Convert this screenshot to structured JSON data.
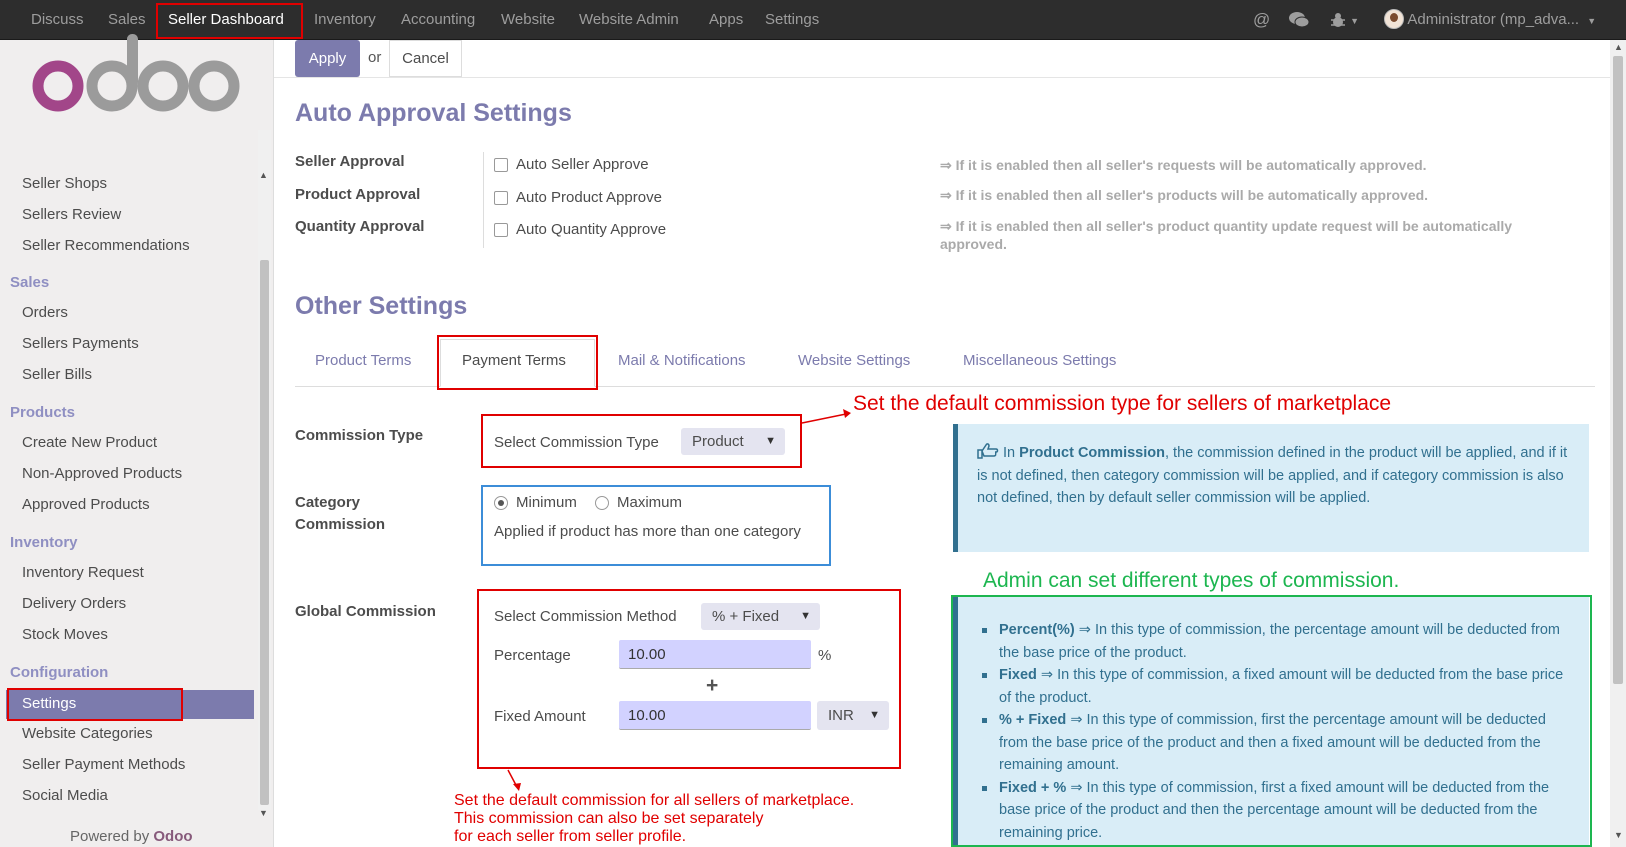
{
  "nav": {
    "items": [
      "Discuss",
      "Sales",
      "Seller Dashboard",
      "Inventory",
      "Accounting",
      "Website",
      "Website Admin",
      "Apps",
      "Settings"
    ],
    "user": "Administrator (mp_adva..."
  },
  "sidebar": {
    "logo_text": "odoo",
    "top_links": [
      "Seller Shops",
      "Sellers Review",
      "Seller Recommendations"
    ],
    "sales_head": "Sales",
    "sales_links": [
      "Orders",
      "Sellers Payments",
      "Seller Bills"
    ],
    "products_head": "Products",
    "products_links": [
      "Create New Product",
      "Non-Approved Products",
      "Approved Products"
    ],
    "inventory_head": "Inventory",
    "inventory_links": [
      "Inventory Request",
      "Delivery Orders",
      "Stock Moves"
    ],
    "config_head": "Configuration",
    "config_active": "Settings",
    "config_links": [
      "Website Categories",
      "Seller Payment Methods",
      "Social Media"
    ],
    "powered_prefix": "Powered by",
    "powered_brand": "Odoo"
  },
  "controls": {
    "apply": "Apply",
    "or": "or",
    "cancel": "Cancel"
  },
  "auto_approval": {
    "title": "Auto Approval Settings",
    "rows": [
      {
        "label": "Seller Approval",
        "checkbox": "Auto Seller Approve",
        "hint": "⇒ If it is enabled then all seller's requests will be automatically approved."
      },
      {
        "label": "Product Approval",
        "checkbox": "Auto Product Approve",
        "hint": "⇒ If it is enabled then all seller's products will be automatically approved."
      },
      {
        "label": "Quantity Approval",
        "checkbox": "Auto Quantity Approve",
        "hint": "⇒ If it is enabled then all seller's product quantity update request will be automatically approved."
      }
    ]
  },
  "other": {
    "title": "Other Settings",
    "tabs": [
      "Product Terms",
      "Payment Terms",
      "Mail & Notifications",
      "Website Settings",
      "Miscellaneous Settings"
    ],
    "commission_type": {
      "label": "Commission Type",
      "field_label": "Select Commission Type",
      "value": "Product"
    },
    "category_commission": {
      "label_line1": "Category",
      "label_line2": "Commission",
      "opt_min": "Minimum",
      "opt_max": "Maximum",
      "help": "Applied if product has more than one category"
    },
    "global_commission": {
      "label": "Global Commission",
      "method_label": "Select Commission Method",
      "method_value": "% + Fixed",
      "percentage_label": "Percentage",
      "percentage_value": "10.00",
      "percent_sign": "%",
      "plus": "+",
      "fixed_label": "Fixed Amount",
      "fixed_value": "10.00",
      "currency": "INR"
    }
  },
  "info": {
    "intro_pre": "In",
    "intro_bold": "Product Commission",
    "intro_post": ", the commission defined in the product will be applied, and if it is not defined, then category commission will be applied, and if category commission is also not defined, then by default seller commission will be applied.",
    "bullets": [
      {
        "term": "Percent(%)",
        "text": " ⇒ In this type of commission, the percentage amount will be deducted from the base price of the product."
      },
      {
        "term": "Fixed",
        "text": " ⇒ In this type of commission, a fixed amount will be deducted from the base price of the product."
      },
      {
        "term": "% + Fixed",
        "text": " ⇒ In this type of commission, first the percentage amount will be deducted from the base price of the product and then a fixed amount will be deducted from the remaining amount."
      },
      {
        "term": "Fixed + %",
        "text": " ⇒ In this type of commission, first a fixed amount will be deducted from the base price of the product and then the percentage amount will be deducted from the remaining price."
      }
    ]
  },
  "annotations": {
    "commission_type": "Set the default commission type for sellers of marketplace",
    "admin_types": "Admin can set different types of commission.",
    "global_line1": "Set the default commission for all sellers of marketplace.",
    "global_line2": "This commission can also be set separately",
    "global_line3": " for each seller from seller profile."
  },
  "colors": {
    "accent": "#7c7bad",
    "annotation_red": "#e00000",
    "annotation_green": "#1db650",
    "annotation_blue": "#3c8dd8",
    "info_bg": "#d9edf7"
  }
}
